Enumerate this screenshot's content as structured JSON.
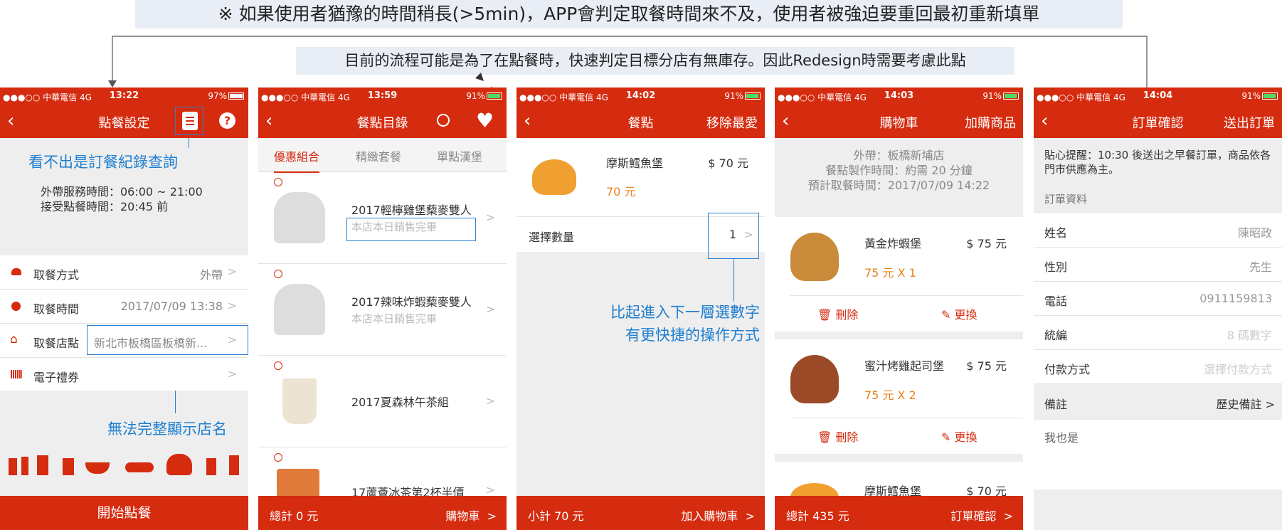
{
  "annotations": {
    "banner": "※ 如果使用者猶豫的時間稍長(>5min)，APP會判定取餐時間來不及，使用者被強迫要重回最初重新填單",
    "flow_note": "目前的流程可能是為了在點餐時，快速判定目標分店有無庫存。因此Redesign時需要考慮此點",
    "note_record": "看不出是訂餐紀錄查詢",
    "note_store": "無法完整顯示店名",
    "note_qty_line1": "比起進入下一層選數字",
    "note_qty_line2": "有更快捷的操作方式"
  },
  "status": {
    "carrier": "●●●○○ 中華電信  4G",
    "s1_time": "13:22",
    "s1_batt": "97%",
    "s2_time": "13:59",
    "s3_time": "14:02",
    "s4_time": "14:03",
    "s5_time": "14:04",
    "batt": "91%"
  },
  "screen1": {
    "title": "點餐設定",
    "service_hours": "外帶服務時間：06:00 ~ 21:00",
    "order_deadline": "接受點餐時間：20:45 前",
    "rows": [
      {
        "icon": "burger-icon",
        "label": "取餐方式",
        "value": "外帶"
      },
      {
        "icon": "clock-icon",
        "label": "取餐時間",
        "value": "2017/07/09 13:38"
      },
      {
        "icon": "home-icon",
        "label": "取餐店點",
        "value": "新北市板橋區板橋新..."
      },
      {
        "icon": "barcode-icon",
        "label": "電子禮券",
        "value": ""
      }
    ],
    "start_button": "開始點餐"
  },
  "screen2": {
    "title": "餐點目錄",
    "tabs": [
      "優惠組合",
      "精緻套餐",
      "單點漢堡"
    ],
    "items": [
      {
        "name": "2017輕檸雞堡蔾麥雙人",
        "status": "本店本日銷售完畢"
      },
      {
        "name": "2017辣味炸蝦蔾麥雙人",
        "status": "本店本日銷售完畢"
      },
      {
        "name": "2017夏森林午茶組",
        "status": ""
      },
      {
        "name": "17蘆薈冰茶第2杯半價",
        "status": ""
      }
    ],
    "total": "總計 0 元",
    "cart": "購物車"
  },
  "screen3": {
    "title": "餐點",
    "right": "移除最愛",
    "item_name": "摩斯鱈魚堡",
    "item_price": "$ 70 元",
    "item_sub": "70 元",
    "qty_label": "選擇數量",
    "qty_value": "1",
    "subtotal": "小計 70 元",
    "add": "加入購物車"
  },
  "screen4": {
    "title": "購物車",
    "right": "加購商品",
    "info1": "外帶：板橋新埔店",
    "info2": "餐點製作時間：約需 20 分鐘",
    "info3": "預計取餐時間：2017/07/09 14:22",
    "items": [
      {
        "name": "黃金炸蝦堡",
        "price": "$ 75 元",
        "qty": "75 元 X 1"
      },
      {
        "name": "蜜汁烤雞起司堡",
        "price": "$ 75 元",
        "qty": "75 元 X 2"
      },
      {
        "name": "摩斯鱈魚堡",
        "price": "$ 70 元",
        "qty": ""
      }
    ],
    "delete": "刪除",
    "replace": "更換",
    "total": "總計 435 元",
    "confirm": "訂單確認"
  },
  "screen5": {
    "title": "訂單確認",
    "right": "送出訂單",
    "reminder": "貼心提醒：10:30 後送出之早餐訂單，商品依各門市供應為主。",
    "section": "訂單資料",
    "fields": [
      {
        "label": "姓名",
        "value": "陳昭政"
      },
      {
        "label": "性別",
        "value": "先生"
      },
      {
        "label": "電話",
        "value": "0911159813"
      },
      {
        "label": "統編",
        "value": "8 碼數字"
      },
      {
        "label": "付款方式",
        "value": "選擇付款方式"
      }
    ],
    "remark_label": "備註",
    "remark_link": "歷史備註",
    "remark_text": "我也是"
  },
  "colors": {
    "brand_red": "#d52b0f",
    "annotation_blue": "#1e7fd0",
    "price_orange": "#e8821d"
  }
}
